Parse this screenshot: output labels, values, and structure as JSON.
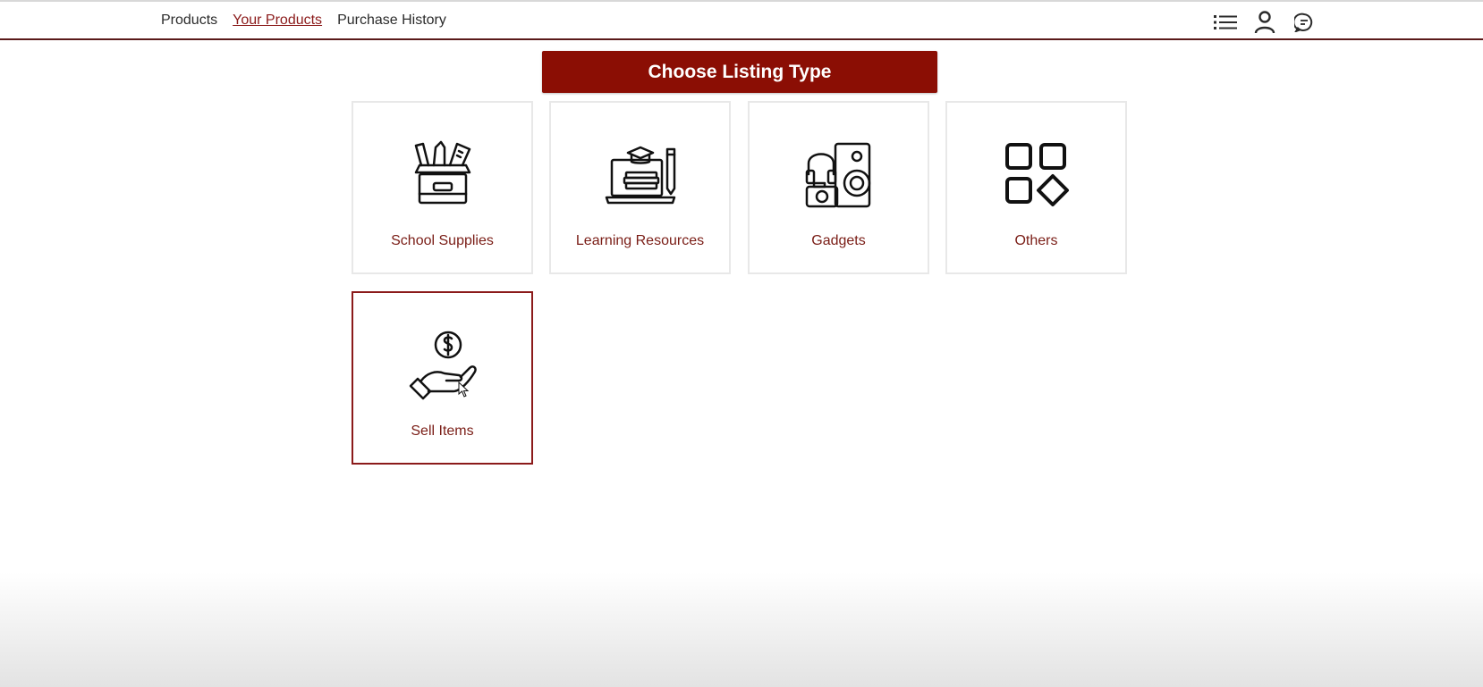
{
  "nav": {
    "links": [
      {
        "label": "Products",
        "active": false
      },
      {
        "label": "Your Products",
        "active": true
      },
      {
        "label": "Purchase History",
        "active": false
      }
    ],
    "icons": [
      "list-icon",
      "user-icon",
      "chat-icon"
    ]
  },
  "banner": {
    "title": "Choose Listing Type"
  },
  "cards": [
    {
      "label": "School Supplies",
      "icon": "school-supplies-icon",
      "selected": false
    },
    {
      "label": "Learning Resources",
      "icon": "learning-resources-icon",
      "selected": false
    },
    {
      "label": "Gadgets",
      "icon": "gadgets-icon",
      "selected": false
    },
    {
      "label": "Others",
      "icon": "others-icon",
      "selected": false
    },
    {
      "label": "Sell Items",
      "icon": "sell-items-icon",
      "selected": true
    }
  ],
  "colors": {
    "brand": "#8b0e04",
    "accent_text": "#7a1d16",
    "nav_border": "#5a1a1a"
  }
}
